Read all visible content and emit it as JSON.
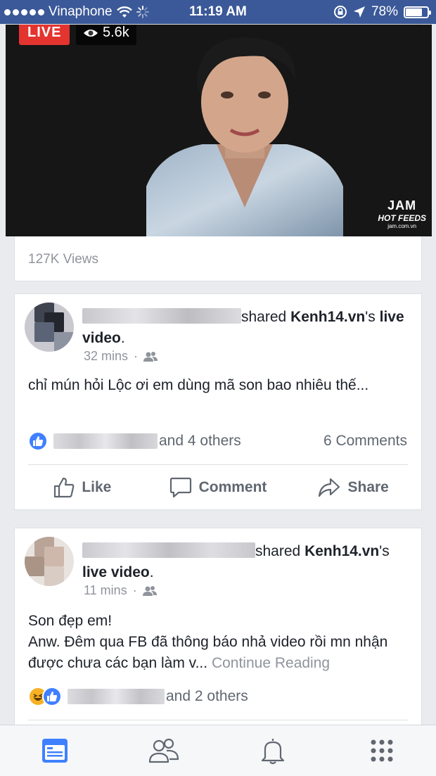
{
  "status_bar": {
    "carrier": "Vinaphone",
    "time": "11:19 AM",
    "battery_percent": "78%",
    "battery_level": 0.78,
    "icons": [
      "signal-dots-icon",
      "wifi-icon",
      "loading-spinner-icon",
      "rotation-lock-icon",
      "location-arrow-icon",
      "battery-icon"
    ]
  },
  "live_card": {
    "live_label": "LIVE",
    "viewer_count": "5.6k",
    "watermark_line1": "JAM",
    "watermark_line2": "HOT FEEDS",
    "watermark_url": "jam.com.vn",
    "views": "127K Views"
  },
  "posts": [
    {
      "shared_text": "shared",
      "page_name": "Kenh14.vn",
      "possessive": "'s",
      "object": "live video",
      "period": ".",
      "time": "32 mins",
      "separator": "·",
      "privacy_icon": "friends-icon",
      "text": "chỉ mún hỏi Lộc ơi em dùng mã son bao nhiêu thế...",
      "reactions_others": "and 4 others",
      "comments": "6 Comments",
      "reactions": [
        "like"
      ]
    },
    {
      "shared_text": "shared",
      "page_name": "Kenh14.vn",
      "possessive": "'s",
      "object": "live video",
      "period": ".",
      "time": "11 mins",
      "separator": "·",
      "privacy_icon": "friends-icon",
      "text_line1": "Son đẹp em!",
      "text_rest": "Anw. Đêm qua FB đã thông báo nhả video rồi mn nhận được chưa các bạn làm v...",
      "continue_label": "Continue Reading",
      "reactions_others": "and 2 others",
      "reactions": [
        "haha",
        "like"
      ]
    }
  ],
  "actions": {
    "like": "Like",
    "comment": "Comment",
    "share": "Share"
  },
  "tab_bar": {
    "tabs": [
      "news-feed-icon",
      "friends-icon",
      "notifications-bell-icon",
      "more-menu-icon"
    ],
    "active": "news-feed-icon"
  },
  "colors": {
    "brand": "#3b5998",
    "like_blue": "#4080ff",
    "live_red": "#e3342f",
    "meta_gray": "#90949c"
  }
}
